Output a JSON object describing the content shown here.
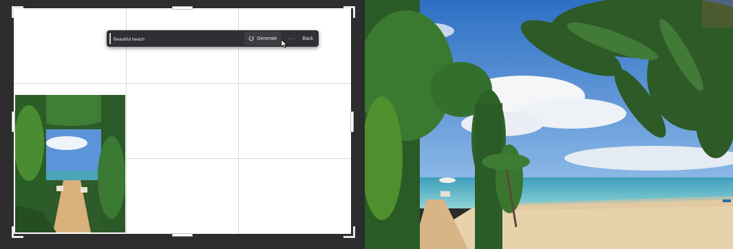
{
  "prompt_bar": {
    "input_value": "Beautiful beach",
    "generate_label": "Generate",
    "more_label": "···",
    "back_label": "Back"
  },
  "colors": {
    "panel_bg": "#2d2d2d",
    "canvas_bg": "#ffffff",
    "sky": "#3e7fcf",
    "sea": "#5cb8c9",
    "sand": "#e6cfa8",
    "foliage": "#2f6a2b"
  },
  "icons": [
    "generate-icon",
    "more-icon",
    "mouse-cursor-icon"
  ]
}
